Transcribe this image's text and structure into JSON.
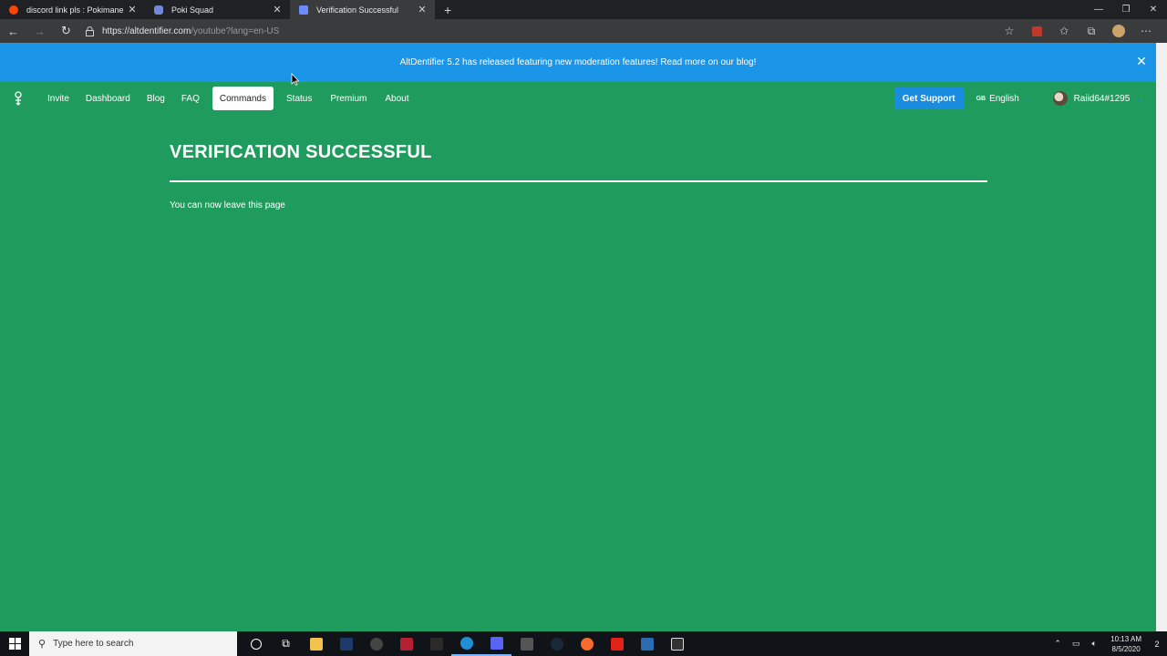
{
  "browser": {
    "tabs": [
      {
        "title": "discord link pls : Pokimane",
        "favicon_color": "#ff4500",
        "icon": "reddit-icon"
      },
      {
        "title": "Poki Squad",
        "favicon_color": "#7289da",
        "icon": "discord-icon"
      },
      {
        "title": "Verification Successful",
        "favicon_color": "#6b8cff",
        "icon": "altdentifier-icon"
      }
    ],
    "new_tab": "+",
    "url_main": "https://altdentifier.com",
    "url_rest": "/youtube?lang=en-US"
  },
  "banner": {
    "text": "AltDentifier 5.2 has released featuring new moderation features! Read more on our blog!"
  },
  "nav": {
    "links": [
      "Invite",
      "Dashboard",
      "Blog",
      "FAQ",
      "Commands",
      "Status",
      "Premium",
      "About"
    ],
    "active": "Commands",
    "support_label": "Get Support",
    "lang_flag": "GB",
    "lang_label": "English",
    "user_label": "Raiid64#1295"
  },
  "content": {
    "title": "VERIFICATION SUCCESSFUL",
    "message": "You can now leave this page"
  },
  "taskbar": {
    "search_placeholder": "Type here to search",
    "time": "10:13 AM",
    "date": "8/5/2020",
    "notifications": "2"
  },
  "colors": {
    "page_bg": "#1f9c5d",
    "banner_bg": "#1a95e8",
    "support_bg": "#1a8ce0"
  }
}
